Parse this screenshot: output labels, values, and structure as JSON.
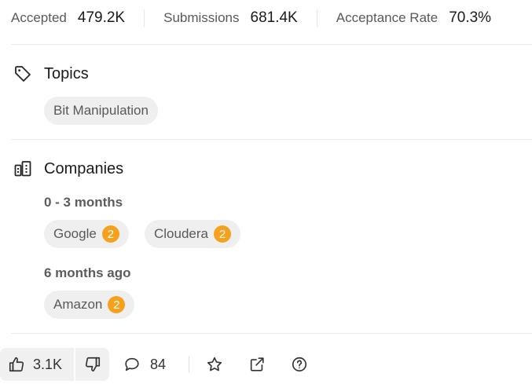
{
  "stats": {
    "accepted_label": "Accepted",
    "accepted_value": "479.2K",
    "submissions_label": "Submissions",
    "submissions_value": "681.4K",
    "rate_label": "Acceptance Rate",
    "rate_value": "70.3%"
  },
  "topics": {
    "title": "Topics",
    "icon": "tag-icon",
    "items": [
      "Bit Manipulation"
    ]
  },
  "companies": {
    "title": "Companies",
    "icon": "building-icon",
    "groups": [
      {
        "period": "0 - 3 months",
        "items": [
          {
            "name": "Google",
            "count": "2"
          },
          {
            "name": "Cloudera",
            "count": "2"
          }
        ]
      },
      {
        "period": "6 months ago",
        "items": [
          {
            "name": "Amazon",
            "count": "2"
          }
        ]
      }
    ]
  },
  "actions": {
    "likes": "3.1K",
    "comments": "84",
    "like_icon": "thumbs-up-icon",
    "dislike_icon": "thumbs-down-icon",
    "comment_icon": "comment-icon",
    "star_icon": "star-icon",
    "share_icon": "external-link-icon",
    "help_icon": "help-icon"
  },
  "colors": {
    "badge": "#f5a11c",
    "pill_bg": "#efefef"
  }
}
